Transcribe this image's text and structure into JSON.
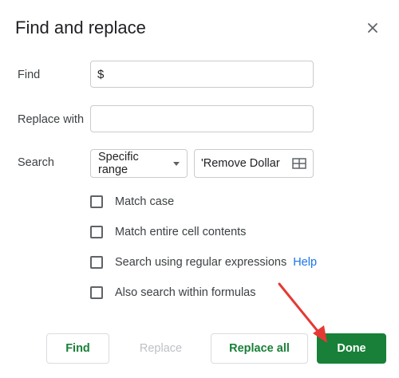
{
  "dialog": {
    "title": "Find and replace",
    "close_icon": "close-icon"
  },
  "find": {
    "label": "Find",
    "value": "$"
  },
  "replace": {
    "label": "Replace with",
    "value": ""
  },
  "search": {
    "label": "Search",
    "scope_selected": "Specific range",
    "range_value": "'Remove Dollar",
    "range_icon": "grid-icon"
  },
  "options": [
    {
      "label": "Match case",
      "checked": false
    },
    {
      "label": "Match entire cell contents",
      "checked": false
    },
    {
      "label": "Search using regular expressions",
      "checked": false,
      "help": "Help"
    },
    {
      "label": "Also search within formulas",
      "checked": false
    }
  ],
  "buttons": {
    "find": "Find",
    "replace": "Replace",
    "replace_all": "Replace all",
    "done": "Done"
  },
  "colors": {
    "accent_green": "#188038",
    "link_blue": "#1a73e8",
    "annotation_arrow": "#e53935"
  }
}
